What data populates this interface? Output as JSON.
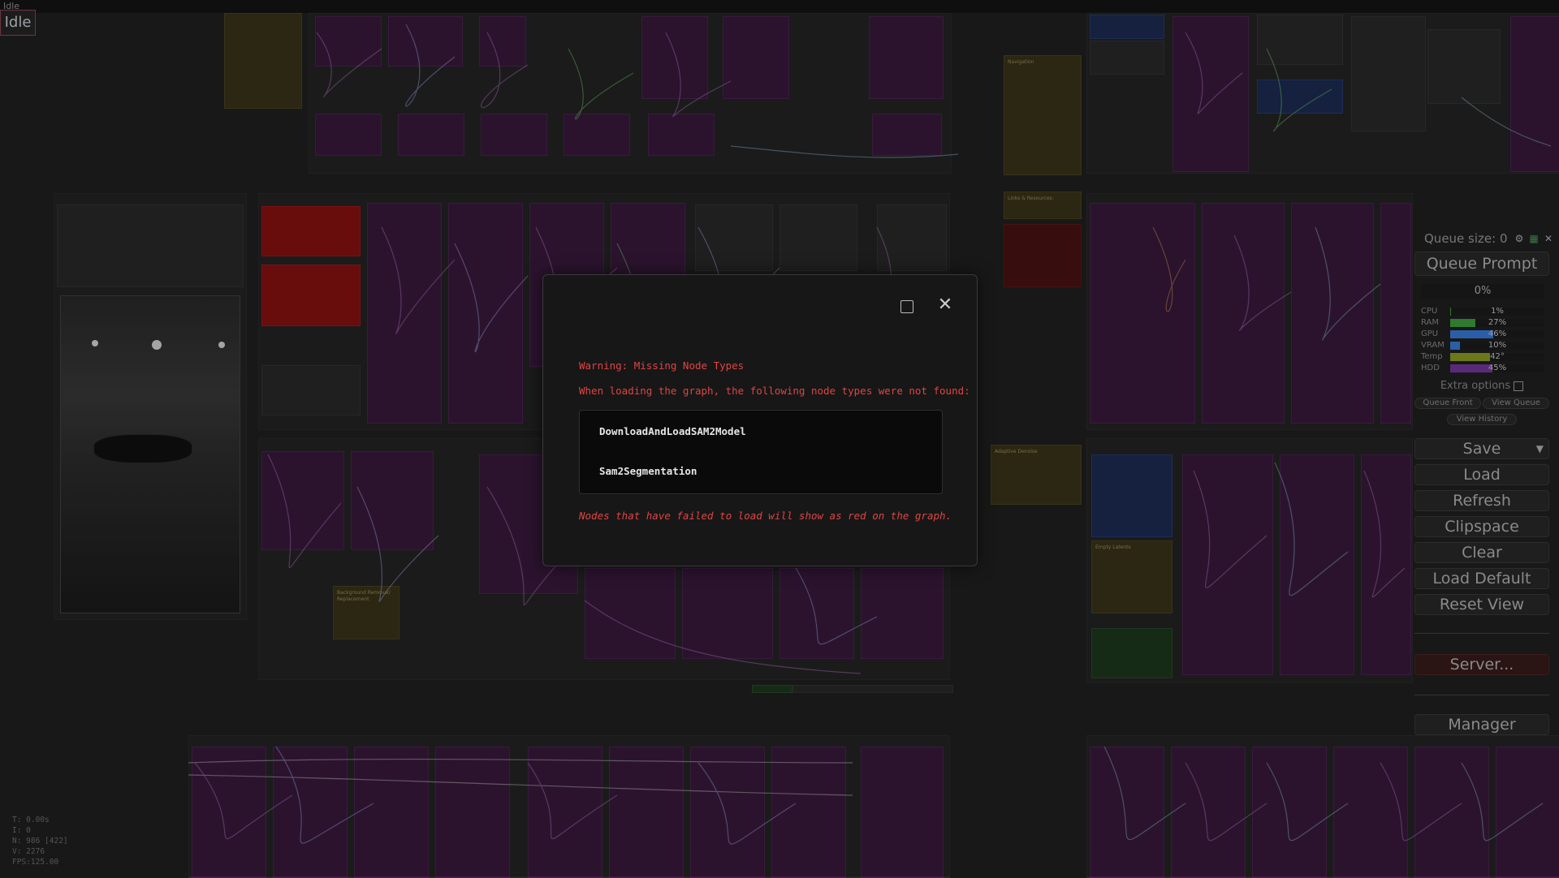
{
  "app": {
    "status": "Idle",
    "corner_label": "Idle"
  },
  "dialog": {
    "title": "Warning: Missing Node Types",
    "subtitle": "When loading the graph, the following node types were not found:",
    "missing_nodes": [
      "DownloadAndLoadSAM2Model",
      "Sam2Segmentation"
    ],
    "footer": "Nodes that have failed to load will show as red on the graph."
  },
  "menu": {
    "queue_size_label": "Queue size: 0",
    "queue_prompt": "Queue Prompt",
    "progress": "0%",
    "stats": [
      {
        "label": "CPU",
        "value": "1%",
        "fill": 0.01,
        "color": "#2f7a2f"
      },
      {
        "label": "RAM",
        "value": "27%",
        "fill": 0.27,
        "color": "#2f7a2f"
      },
      {
        "label": "GPU",
        "value": "46%",
        "fill": 0.46,
        "color": "#2a5fa8"
      },
      {
        "label": "VRAM",
        "value": "10%",
        "fill": 0.1,
        "color": "#2a5fa8"
      },
      {
        "label": "Temp",
        "value": "42°",
        "fill": 0.42,
        "color": "#6a7a1a"
      },
      {
        "label": "HDD",
        "value": "45%",
        "fill": 0.45,
        "color": "#5a2a7a"
      }
    ],
    "extra_options": "Extra options",
    "queue_front": "Queue Front",
    "view_queue": "View Queue",
    "view_history": "View History",
    "save": "Save",
    "load": "Load",
    "refresh": "Refresh",
    "clipspace": "Clipspace",
    "clear": "Clear",
    "load_default": "Load Default",
    "reset_view": "Reset View",
    "server": "Server...",
    "manager": "Manager"
  },
  "canvas_stats": [
    "T: 0.00s",
    "I: 0",
    "N: 986 [422]",
    "V: 2276",
    "FPS:125.00"
  ],
  "notes": {
    "navigation": "Navigation",
    "links": "Links & Resources:",
    "adaptive": "Adaptive Denoise",
    "empty_latents": "Empty Latents",
    "background": "Background Removal/ Replacement"
  },
  "colors": {
    "accent_red": "#e04444",
    "node_purple": "#3a1a3e"
  }
}
